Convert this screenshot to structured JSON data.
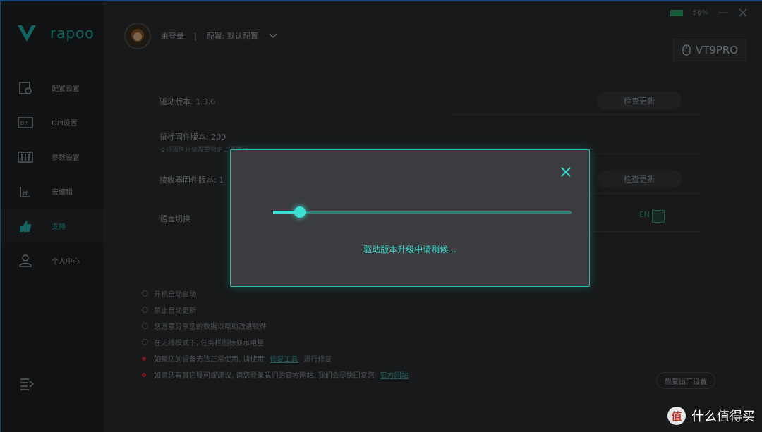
{
  "brand": {
    "name": "rapoo",
    "accent": "#1fb8b3"
  },
  "sidebar": {
    "items": [
      {
        "label": "配置设置",
        "icon": "profile-icon"
      },
      {
        "label": "DPI设置",
        "icon": "dpi-icon"
      },
      {
        "label": "参数设置",
        "icon": "parameter-icon"
      },
      {
        "label": "宏编辑",
        "icon": "macro-icon"
      },
      {
        "label": "支持",
        "icon": "thumbs-up-icon",
        "active": true
      },
      {
        "label": "个人中心",
        "icon": "user-icon"
      }
    ]
  },
  "topbar": {
    "user": "未登录",
    "separator": "|",
    "profile": "配置: 默认配置"
  },
  "window": {
    "battery": "56%"
  },
  "device": {
    "model": "VT9PRO"
  },
  "support": {
    "driver_version": "驱动版本: 1.3.6",
    "check_update": "检查更新",
    "mouse_fw": "鼠标固件版本: 209",
    "mouse_fw_sub": "支持固件升级需要特定工具进行",
    "receiver_fw": "接收器固件版本: 1",
    "check_update_2": "检查更新",
    "language": "语言切换",
    "lang_value": "EN"
  },
  "options": [
    "开机自动启动",
    "禁止自动更新",
    "您愿意分享您的数据以帮助改进软件",
    "在无线模式下, 任务栏图标显示电量"
  ],
  "notes": [
    {
      "text": "如果您的设备无法正常使用, 请使用",
      "link": "修复工具",
      "tail": "进行修复"
    },
    {
      "text": "如果您有其它疑问或建议, 请您登录我们的官方网站, 我们会尽快回复您",
      "link": "官方网站",
      "tail": ""
    }
  ],
  "reset_label": "恢复出厂设置",
  "dialog": {
    "progress": 0.09,
    "message": "驱动版本升级中请稍候..."
  },
  "watermark": {
    "icon_char": "值",
    "text": "什么值得买"
  }
}
